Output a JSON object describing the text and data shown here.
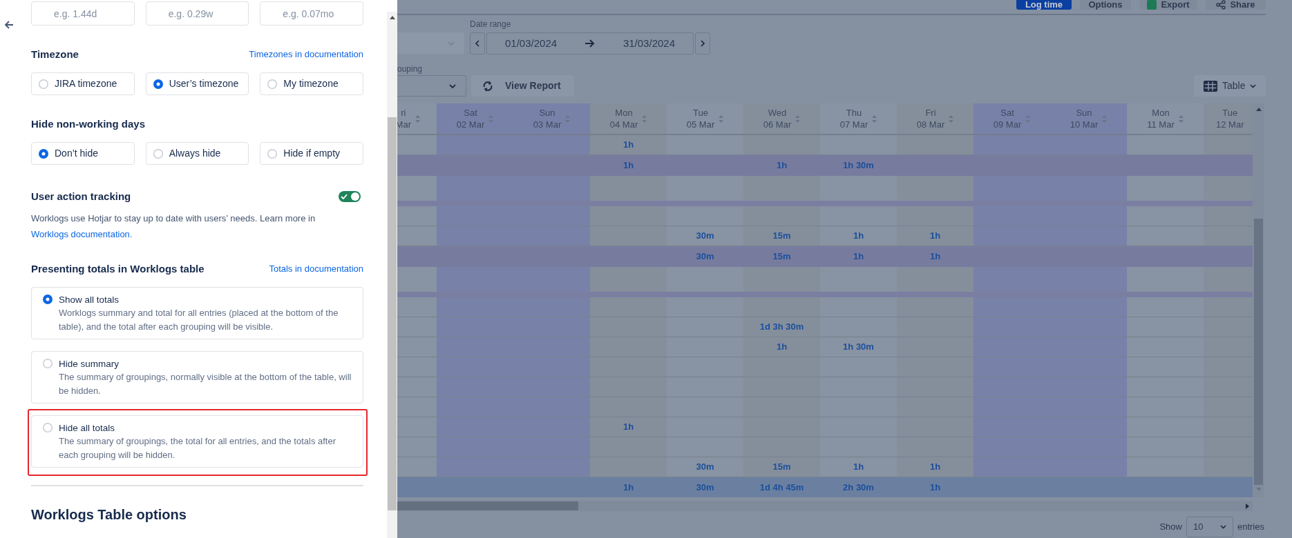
{
  "panel": {
    "format_fields": [
      {
        "placeholder": "e.g. 1.44d"
      },
      {
        "placeholder": "e.g. 0.29w"
      },
      {
        "placeholder": "e.g. 0.07mo"
      }
    ],
    "timezone": {
      "title": "Timezone",
      "link": "Timezones in documentation",
      "options": [
        {
          "label": "JIRA timezone",
          "selected": false
        },
        {
          "label": "User’s timezone",
          "selected": true
        },
        {
          "label": "My timezone",
          "selected": false
        }
      ]
    },
    "hide_non_working_days": {
      "title": "Hide non-working days",
      "options": [
        {
          "label": "Don’t hide",
          "selected": true
        },
        {
          "label": "Always hide",
          "selected": false
        },
        {
          "label": "Hide if empty",
          "selected": false
        }
      ]
    },
    "user_action_tracking": {
      "title": "User action tracking",
      "on": true,
      "description": "Worklogs use Hotjar to stay up to date with users’ needs. Learn more in",
      "link": "Worklogs documentation."
    },
    "presenting_totals": {
      "title": "Presenting totals in Worklogs table",
      "link": "Totals in documentation",
      "options": [
        {
          "label": "Show all totals",
          "description": "Worklogs summary and total for all entries (placed at the bottom of the table), and the total after each grouping will be visible.",
          "selected": true,
          "highlighted": false
        },
        {
          "label": "Hide summary",
          "description": "The summary of groupings, normally visible at the bottom of the table, will be hidden.",
          "selected": false,
          "highlighted": false
        },
        {
          "label": "Hide all totals",
          "description": "The summary of groupings, the total for all entries, and the totals after each grouping will be hidden.",
          "selected": false,
          "highlighted": true
        }
      ]
    },
    "next_section_title": "Worklogs Table options"
  },
  "report": {
    "toolbar_buttons": [
      {
        "label": "Log time",
        "kind": "primary"
      },
      {
        "label": "Options",
        "kind": "default"
      },
      {
        "label": "Export",
        "kind": "export"
      },
      {
        "label": "Share",
        "kind": "share"
      }
    ],
    "date_range": {
      "label": "Date range",
      "start": "01/03/2024",
      "end": "31/03/2024"
    },
    "grouping": {
      "label": "ouping"
    },
    "view_report_button": "View Report",
    "view_button": "Table",
    "table": {
      "columns": [
        {
          "day": "ri",
          "date": "Mar",
          "weekend": false
        },
        {
          "day": "Sat",
          "date": "02 Mar",
          "weekend": true
        },
        {
          "day": "Sun",
          "date": "03 Mar",
          "weekend": true
        },
        {
          "day": "Mon",
          "date": "04 Mar",
          "weekend": false
        },
        {
          "day": "Tue",
          "date": "05 Mar",
          "weekend": false
        },
        {
          "day": "Wed",
          "date": "06 Mar",
          "weekend": false
        },
        {
          "day": "Thu",
          "date": "07 Mar",
          "weekend": false
        },
        {
          "day": "Fri",
          "date": "08 Mar",
          "weekend": false
        },
        {
          "day": "Sat",
          "date": "09 Mar",
          "weekend": true
        },
        {
          "day": "Sun",
          "date": "10 Mar",
          "weekend": true
        },
        {
          "day": "Mon",
          "date": "11 Mar",
          "weekend": false
        },
        {
          "day": "Tue",
          "date": "12 Mar",
          "weekend": false
        }
      ],
      "rows": [
        {
          "kind": "entry",
          "cells": [
            null,
            null,
            null,
            "1h",
            null,
            null,
            null,
            null,
            null,
            null,
            null,
            null
          ]
        },
        {
          "kind": "subtotal",
          "cells": [
            null,
            null,
            null,
            "1h",
            null,
            "1h",
            "1h 30m",
            null,
            null,
            null,
            null,
            null
          ]
        },
        {
          "kind": "group"
        },
        {
          "kind": "entry",
          "cells": [
            null,
            null,
            null,
            null,
            null,
            null,
            null,
            null,
            null,
            null,
            null,
            null
          ]
        },
        {
          "kind": "entry",
          "cells": [
            null,
            null,
            null,
            null,
            "30m",
            "15m",
            "1h",
            "1h",
            null,
            null,
            null,
            null
          ]
        },
        {
          "kind": "subtotal",
          "cells": [
            null,
            null,
            null,
            null,
            "30m",
            "15m",
            "1h",
            "1h",
            null,
            null,
            null,
            null
          ]
        },
        {
          "kind": "group"
        },
        {
          "kind": "entry",
          "cells": [
            null,
            null,
            null,
            null,
            null,
            null,
            null,
            null,
            null,
            null,
            null,
            null
          ]
        },
        {
          "kind": "entry",
          "cells": [
            null,
            null,
            null,
            null,
            null,
            "1d 3h 30m",
            null,
            null,
            null,
            null,
            null,
            null
          ]
        },
        {
          "kind": "entry",
          "cells": [
            null,
            null,
            null,
            null,
            null,
            "1h",
            "1h 30m",
            null,
            null,
            null,
            null,
            null
          ]
        },
        {
          "kind": "entry",
          "cells": [
            null,
            null,
            null,
            null,
            null,
            null,
            null,
            null,
            null,
            null,
            null,
            null
          ]
        },
        {
          "kind": "entry",
          "cells": [
            null,
            null,
            null,
            null,
            null,
            null,
            null,
            null,
            null,
            null,
            null,
            null
          ]
        },
        {
          "kind": "entry",
          "cells": [
            null,
            null,
            null,
            null,
            null,
            null,
            null,
            null,
            null,
            null,
            null,
            null
          ]
        },
        {
          "kind": "entry",
          "cells": [
            null,
            null,
            null,
            "1h",
            null,
            null,
            null,
            null,
            null,
            null,
            null,
            null
          ]
        },
        {
          "kind": "entry",
          "cells": [
            null,
            null,
            null,
            null,
            null,
            null,
            null,
            null,
            null,
            null,
            null,
            null
          ]
        },
        {
          "kind": "entry",
          "cells": [
            null,
            null,
            null,
            null,
            "30m",
            "15m",
            "1h",
            "1h",
            null,
            null,
            null,
            null
          ]
        },
        {
          "kind": "total",
          "cells": [
            null,
            null,
            null,
            "1h",
            "30m",
            "1d 4h 45m",
            "2h 30m",
            "1h",
            null,
            null,
            null,
            null
          ]
        }
      ]
    },
    "pagination": {
      "prefix": "Show",
      "page_size": "10",
      "suffix": "entries"
    }
  }
}
